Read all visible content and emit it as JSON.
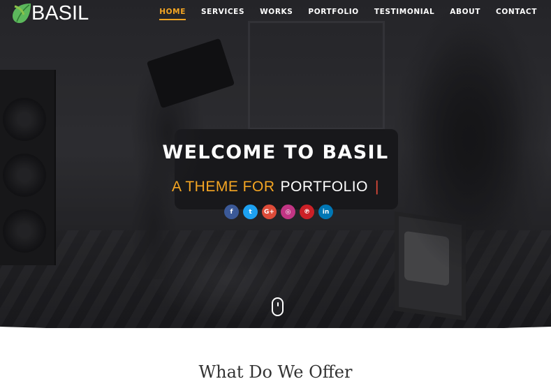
{
  "brand": {
    "name": "BASIL",
    "leaf_color": "#5cb85c"
  },
  "nav": {
    "items": [
      {
        "label": "HOME",
        "active": true
      },
      {
        "label": "SERVICES",
        "active": false
      },
      {
        "label": "WORKS",
        "active": false
      },
      {
        "label": "PORTFOLIO",
        "active": false
      },
      {
        "label": "TESTIMONIAL",
        "active": false
      },
      {
        "label": "ABOUT",
        "active": false
      },
      {
        "label": "CONTACT",
        "active": false
      }
    ],
    "active_color": "#f5a623"
  },
  "hero": {
    "title": "WELCOME TO BASIL",
    "subtitle_prefix": "A THEME FOR",
    "subtitle_word": "PORTFOLIO",
    "cursor": "|",
    "socials": [
      {
        "name": "facebook-icon",
        "glyph": "f",
        "color": "#3b5998"
      },
      {
        "name": "twitter-icon",
        "glyph": "t",
        "color": "#1da1f2"
      },
      {
        "name": "google-plus-icon",
        "glyph": "G+",
        "color": "#dd4b39"
      },
      {
        "name": "instagram-icon",
        "glyph": "◎",
        "color": "#c13584"
      },
      {
        "name": "pinterest-icon",
        "glyph": "℗",
        "color": "#cb2027"
      },
      {
        "name": "linkedin-icon",
        "glyph": "in",
        "color": "#0077b5"
      }
    ]
  },
  "section": {
    "title": "What Do We Offer"
  }
}
